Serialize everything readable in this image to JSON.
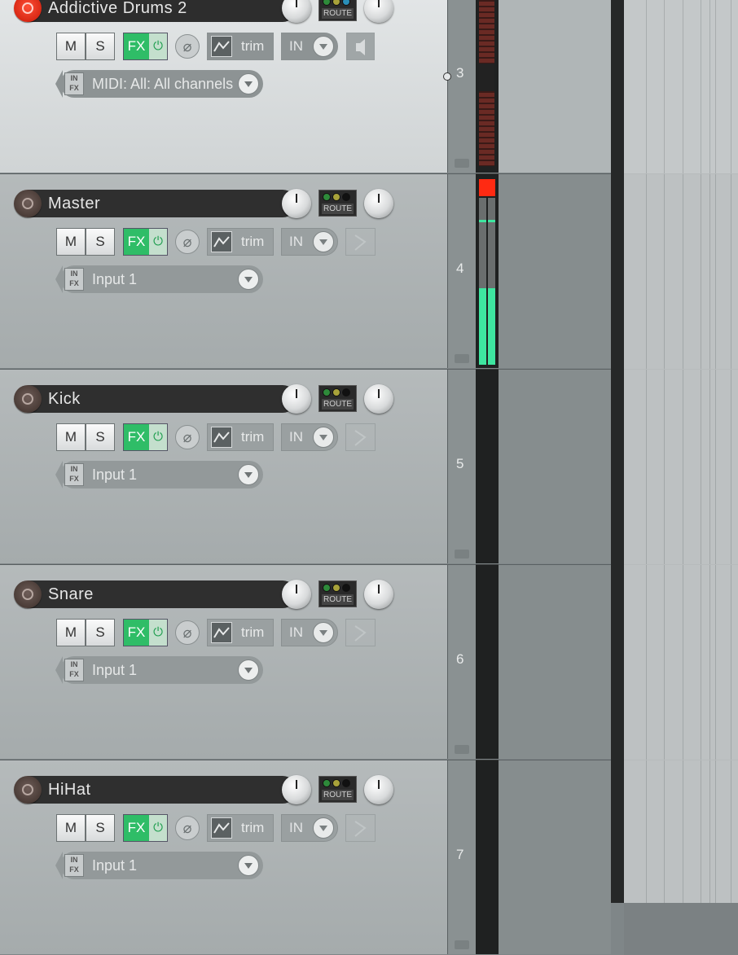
{
  "window": {
    "title": ""
  },
  "tracks": [
    {
      "number": "3",
      "name": "Addictive Drums 2",
      "armed": true,
      "selected": true,
      "mute_label": "M",
      "solo_label": "S",
      "fx_label": "FX",
      "fx_power": "⏻",
      "phase": "⌀",
      "env_label": "trim",
      "in_label": "IN",
      "input": "MIDI: All: All channels",
      "meter": "midi"
    },
    {
      "number": "4",
      "name": "Master",
      "armed": false,
      "selected": false,
      "mute_label": "M",
      "solo_label": "S",
      "fx_label": "FX",
      "fx_power": "⏻",
      "phase": "⌀",
      "env_label": "trim",
      "in_label": "IN",
      "input": "Input 1",
      "meter": "audio-clip"
    },
    {
      "number": "5",
      "name": "Kick",
      "armed": false,
      "selected": false,
      "mute_label": "M",
      "solo_label": "S",
      "fx_label": "FX",
      "fx_power": "⏻",
      "phase": "⌀",
      "env_label": "trim",
      "in_label": "IN",
      "input": "Input 1",
      "meter": "none"
    },
    {
      "number": "6",
      "name": "Snare",
      "armed": false,
      "selected": false,
      "mute_label": "M",
      "solo_label": "S",
      "fx_label": "FX",
      "fx_power": "⏻",
      "phase": "⌀",
      "env_label": "trim",
      "in_label": "IN",
      "input": "Input 1",
      "meter": "none"
    },
    {
      "number": "7",
      "name": "HiHat",
      "armed": false,
      "selected": false,
      "mute_label": "M",
      "solo_label": "S",
      "fx_label": "FX",
      "fx_power": "⏻",
      "phase": "⌀",
      "env_label": "trim",
      "in_label": "IN",
      "input": "Input 1",
      "meter": "none"
    }
  ],
  "route_label": "ROUTE",
  "input_icon_label": "IN FX",
  "colors": {
    "fx_green": "#2fbd67",
    "meter_green": "#3ee6a0",
    "clip_red": "#ff2a12",
    "arm_red": "#e52a16"
  }
}
